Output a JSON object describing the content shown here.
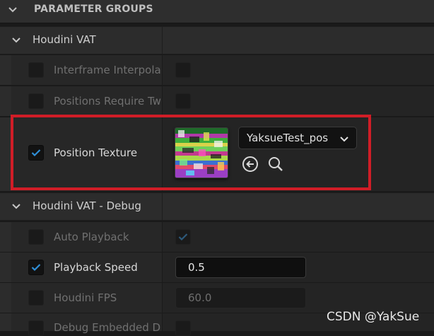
{
  "header": {
    "title": "PARAMETER GROUPS"
  },
  "groups": [
    {
      "title": "Houdini VAT",
      "rows": [
        {
          "label": "Interframe Interpolati",
          "checked": false
        },
        {
          "label": "Positions Require Tw",
          "checked": false
        },
        {
          "label": "Position Texture",
          "checked": true,
          "texture": {
            "asset_name": "YaksueTest_pos",
            "browse_icon": "arrow-left-circle-icon",
            "find_icon": "search-icon"
          }
        }
      ]
    },
    {
      "title": "Houdini VAT - Debug",
      "rows": [
        {
          "label": "Auto Playback",
          "checked": false,
          "value_checked": true
        },
        {
          "label": "Playback Speed",
          "checked": true,
          "value": "0.5"
        },
        {
          "label": "Houdini FPS",
          "checked": false,
          "value": "60.0"
        },
        {
          "label": "Debug Embedded Dat",
          "checked": false
        }
      ]
    }
  ],
  "colors": {
    "highlight_border": "#d01d27",
    "checkmark": "#2f8fd8"
  },
  "watermark": "CSDN @YakSue"
}
